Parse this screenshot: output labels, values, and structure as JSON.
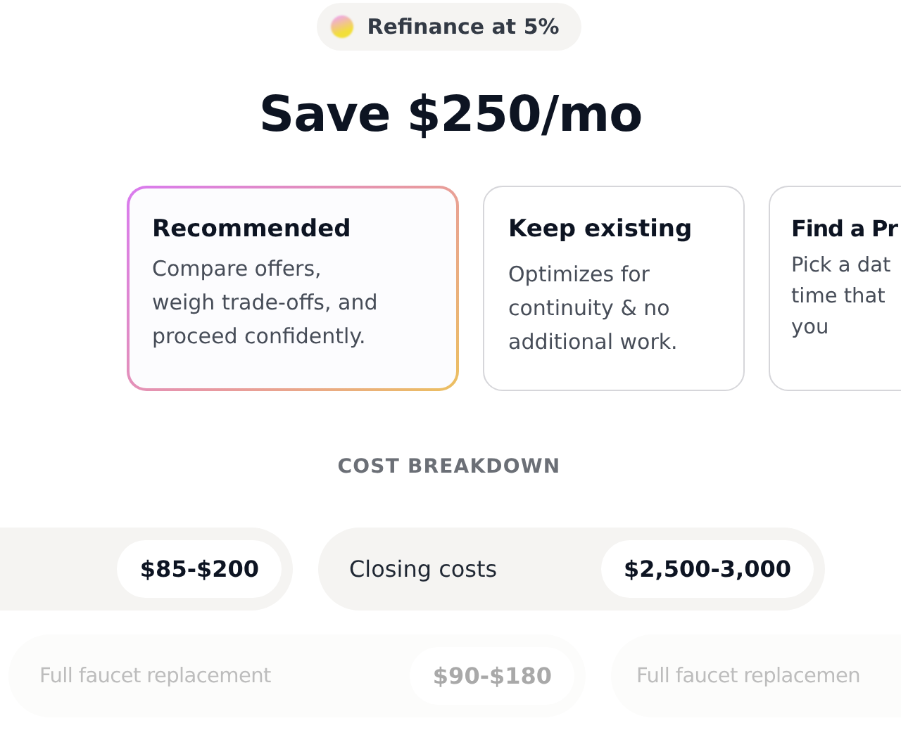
{
  "badge": {
    "label": "Refinance at 5%"
  },
  "headline": "Save $250/mo",
  "options": [
    {
      "title": "Recommended",
      "lines": [
        "Compare offers,",
        "weigh trade-offs, and",
        "proceed confidently."
      ],
      "selected": true
    },
    {
      "title": "Keep existing",
      "lines": [
        "Optimizes for",
        "continuity & no",
        "additional work."
      ],
      "selected": false
    },
    {
      "title": "Find a Pr",
      "lines": [
        "Pick a dat",
        "time that",
        "you"
      ],
      "selected": false
    }
  ],
  "section_title": "COST BREAKDOWN",
  "cost_rows": [
    {
      "faded": false,
      "items": [
        {
          "value": "$85-$200"
        },
        {
          "label": "Closing costs",
          "value": "$2,500-3,000"
        }
      ]
    },
    {
      "faded": true,
      "items": [
        {
          "label": "Full faucet replacement",
          "value": "$90-$180"
        },
        {
          "label": "Full faucet replacemen"
        }
      ]
    }
  ]
}
